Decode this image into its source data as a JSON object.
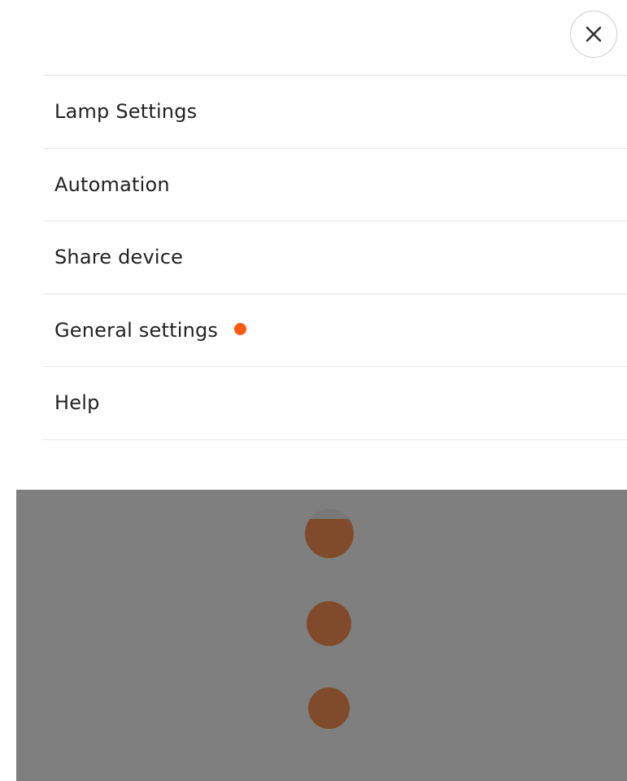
{
  "close_button": {
    "icon": "close-icon"
  },
  "menu": {
    "items": [
      {
        "label": "Lamp Settings",
        "badge": false
      },
      {
        "label": "Automation",
        "badge": false
      },
      {
        "label": "Share device",
        "badge": false
      },
      {
        "label": "General settings",
        "badge": true,
        "badge_color": "#ff5a12"
      },
      {
        "label": "Help",
        "badge": false
      }
    ]
  },
  "overlay": {
    "background_color": "#7f7f7f",
    "dot_color": "#7f4b2a",
    "dot_count": 3
  }
}
